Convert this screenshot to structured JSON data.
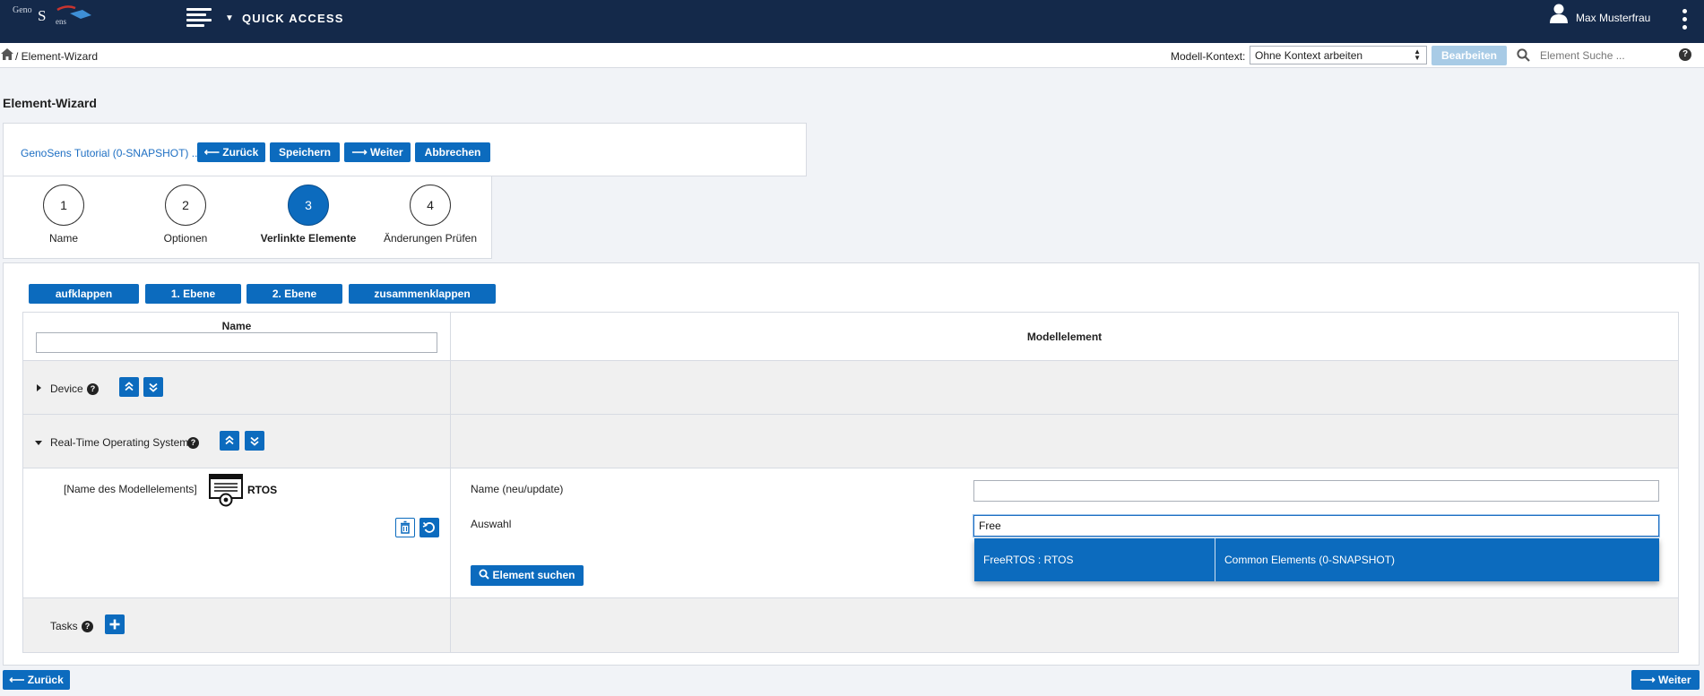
{
  "app": {
    "logo": {
      "line1": "Geno",
      "line2": "S",
      "line3": "ens"
    },
    "quick_access_label": "QUICK ACCESS",
    "user_name": "Max Musterfrau",
    "colors": {
      "topbar": "#14294a",
      "primary": "#0c6bbe",
      "disabled": "#a8cbe6"
    }
  },
  "breadcrumb": {
    "text": "/ Element-Wizard"
  },
  "context": {
    "label": "Modell-Kontext:",
    "selected": "Ohne Kontext arbeiten",
    "edit_button": "Bearbeiten",
    "search_placeholder": "Element Suche ..."
  },
  "page": {
    "title": "Element-Wizard"
  },
  "toolbar": {
    "project_link": "GenoSens Tutorial (0-SNAPSHOT) ...",
    "back": "⟵ Zurück",
    "save": "Speichern",
    "next": "⟶ Weiter",
    "cancel": "Abbrechen"
  },
  "steps": [
    {
      "number": "1",
      "label": "Name",
      "active": false
    },
    {
      "number": "2",
      "label": "Optionen",
      "active": false
    },
    {
      "number": "3",
      "label": "Verlinkte Elemente",
      "active": true
    },
    {
      "number": "4",
      "label": "Änderungen Prüfen",
      "active": false
    }
  ],
  "tree_controls": {
    "expand": "aufklappen",
    "level1": "1. Ebene",
    "level2": "2. Ebene",
    "collapse": "zusammenklappen"
  },
  "table": {
    "col_name": "Name",
    "col_model": "Modellelement",
    "rows": {
      "device": "Device",
      "rtos": "Real-Time Operating System",
      "tasks": "Tasks"
    }
  },
  "detail": {
    "element_name_label": "[Name des Modellelements]",
    "element_value": "RTOS",
    "name_field_label": "Name (neu/update)",
    "name_field_value": "",
    "selection_label": "Auswahl",
    "selection_value": "Free",
    "search_button": "Element suchen"
  },
  "autocomplete": {
    "item": "FreeRTOS : RTOS",
    "source": "Common Elements (0-SNAPSHOT)"
  },
  "footer": {
    "back": "⟵ Zurück",
    "next": "⟶ Weiter"
  }
}
